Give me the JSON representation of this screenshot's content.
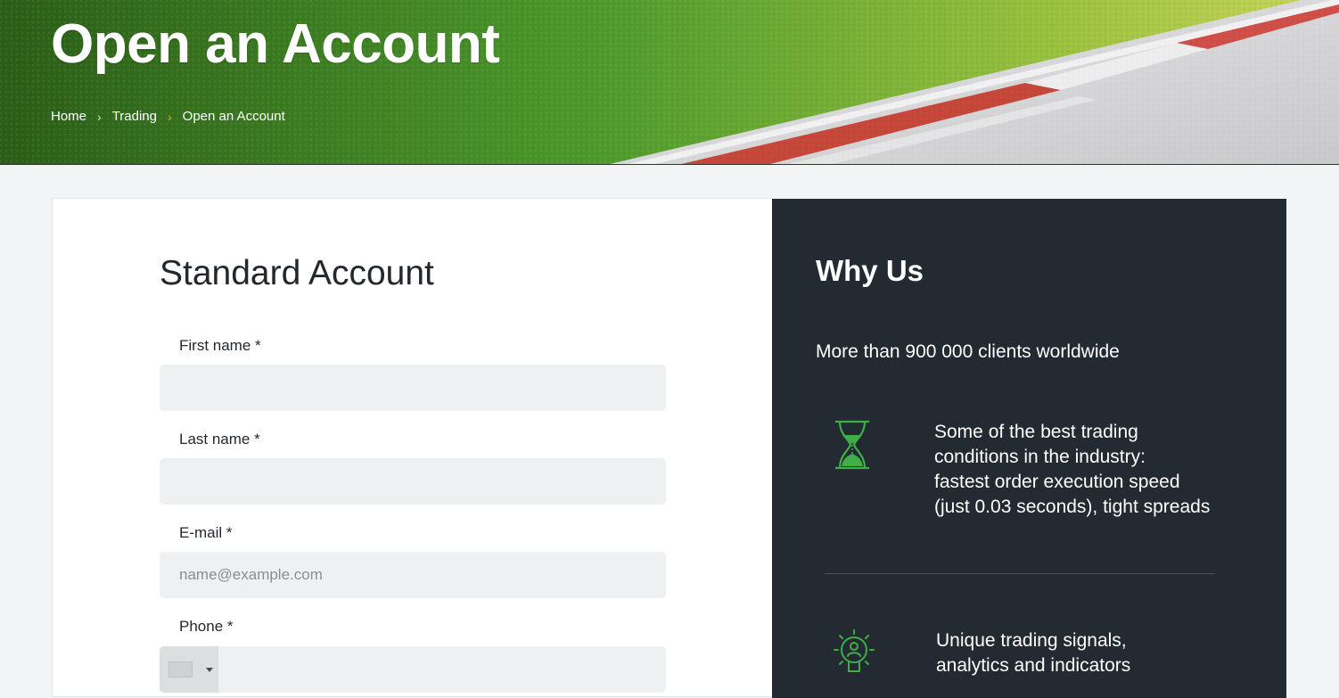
{
  "hero": {
    "title": "Open an Account",
    "breadcrumb": [
      {
        "label": "Home"
      },
      {
        "label": "Trading"
      },
      {
        "label": "Open an Account"
      }
    ],
    "separator": "›"
  },
  "form": {
    "title": "Standard Account",
    "fields": {
      "first_name": {
        "label": "First name *",
        "value": "",
        "placeholder": ""
      },
      "last_name": {
        "label": "Last name *",
        "value": "",
        "placeholder": ""
      },
      "email": {
        "label": "E-mail *",
        "value": "",
        "placeholder": "name@example.com"
      },
      "phone": {
        "label": "Phone *",
        "value": "",
        "placeholder": ""
      }
    }
  },
  "why_us": {
    "title": "Why Us",
    "lead": "More than 900 000 clients worldwide",
    "features": [
      {
        "icon": "hourglass-icon",
        "lines": [
          "Some of the best trading",
          "conditions in the industry:",
          "fastest order execution speed",
          "(just 0.03 seconds), tight spreads"
        ]
      },
      {
        "icon": "lightbulb-icon",
        "lines": [
          "Unique trading signals,",
          "analytics and indicators"
        ]
      }
    ]
  },
  "colors": {
    "accent_green": "#3fae49",
    "panel_dark": "#232a31",
    "breadcrumb_active_separator": "#f5a623"
  }
}
